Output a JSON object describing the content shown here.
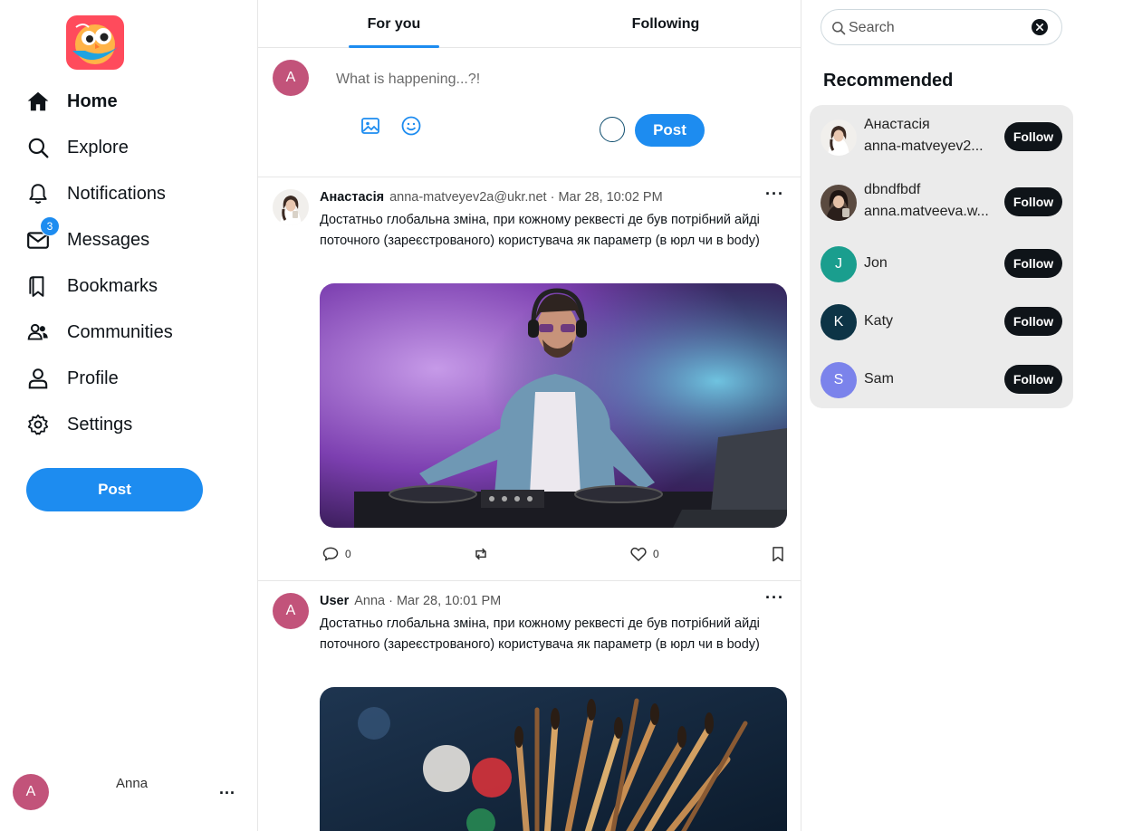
{
  "sidebar": {
    "nav": [
      {
        "label": "Home",
        "icon": "home-icon"
      },
      {
        "label": "Explore",
        "icon": "search-icon"
      },
      {
        "label": "Notifications",
        "icon": "bell-icon"
      },
      {
        "label": "Messages",
        "icon": "mail-icon",
        "badge": "3"
      },
      {
        "label": "Bookmarks",
        "icon": "bookmarks-icon"
      },
      {
        "label": "Communities",
        "icon": "people-icon"
      },
      {
        "label": "Profile",
        "icon": "user-icon"
      },
      {
        "label": "Settings",
        "icon": "gear-icon"
      }
    ],
    "post_label": "Post",
    "account": {
      "initial": "A",
      "name": "Anna",
      "more": "..."
    }
  },
  "tabs": [
    {
      "label": "For you",
      "active": true
    },
    {
      "label": "Following",
      "active": false
    }
  ],
  "composer": {
    "avatar_initial": "A",
    "placeholder": "What is happening...?!",
    "post_label": "Post"
  },
  "posts": [
    {
      "name": "Анастасія",
      "handle": "anna-matveyev2a@ukr.net",
      "time": "Mar 28, 10:02 PM",
      "text": "Достатньо глобальна зміна, при кожному реквесті де був потрібний айді поточного (зареєстрованого) користувача як параметр (в юрл чи в body)",
      "media": "dj-photo",
      "comments": "0",
      "likes": "0"
    },
    {
      "name": "User",
      "handle": "Anna",
      "time": "Mar 28, 10:01 PM",
      "avatar_initial": "A",
      "text": "Достатньо глобальна зміна, при кожному реквесті де був потрібний айді поточного (зареєстрованого) користувача як параметр (в юрл чи в body)",
      "media": "paintbrushes-photo"
    }
  ],
  "search": {
    "placeholder": "Search"
  },
  "recommended": {
    "title": "Recommended",
    "follow_label": "Follow",
    "users": [
      {
        "name": "Анастасія",
        "handle": "anna-matveyev2..."
      },
      {
        "name": "dbndfbdf",
        "handle": "anna.matveeva.w..."
      },
      {
        "name": "Jon",
        "initial": "J",
        "color": "#1a9e8e"
      },
      {
        "name": "Katy",
        "initial": "K",
        "color": "#0d3446"
      },
      {
        "name": "Sam",
        "initial": "S",
        "color": "#7b83eb"
      }
    ]
  },
  "colors": {
    "accent": "#1d8cf0",
    "avatar": "#c2537a",
    "dark": "#0f1419"
  }
}
